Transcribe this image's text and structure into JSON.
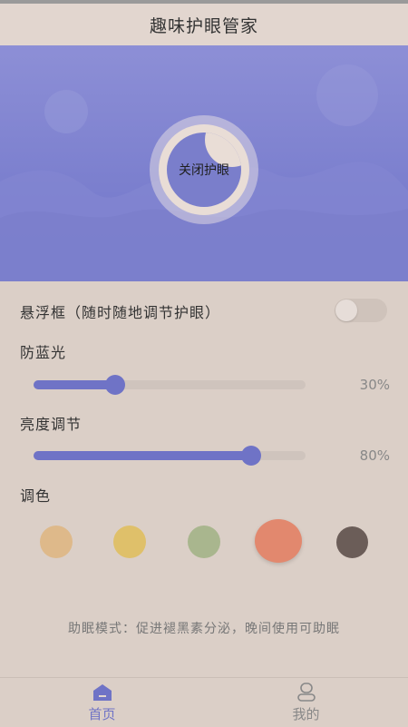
{
  "app_bar": {
    "title": "趣味护眼管家"
  },
  "hero": {
    "toggle_eye_label": "关闭护眼"
  },
  "float_window": {
    "label": "悬浮框（随时随地调节护眼）",
    "enabled": false
  },
  "blue_light": {
    "label": "防蓝光",
    "value": 30,
    "value_text": "30%"
  },
  "brightness": {
    "label": "亮度调节",
    "value": 80,
    "value_text": "80%"
  },
  "color": {
    "label": "调色",
    "swatches": [
      {
        "hex": "#deb98a",
        "selected": false
      },
      {
        "hex": "#dfc06a",
        "selected": false
      },
      {
        "hex": "#a9b68e",
        "selected": false
      },
      {
        "hex": "#e2886e",
        "selected": true
      },
      {
        "hex": "#6b5d58",
        "selected": false
      }
    ]
  },
  "hint": "助眠模式：促进褪黑素分泌，晚间使用可助眠",
  "tabs": [
    {
      "label": "首页",
      "active": true
    },
    {
      "label": "我的",
      "active": false
    }
  ],
  "colors": {
    "accent": "#6f73c6",
    "hero_bg": "#7b7fce",
    "page_bg": "#dbcfc7"
  }
}
